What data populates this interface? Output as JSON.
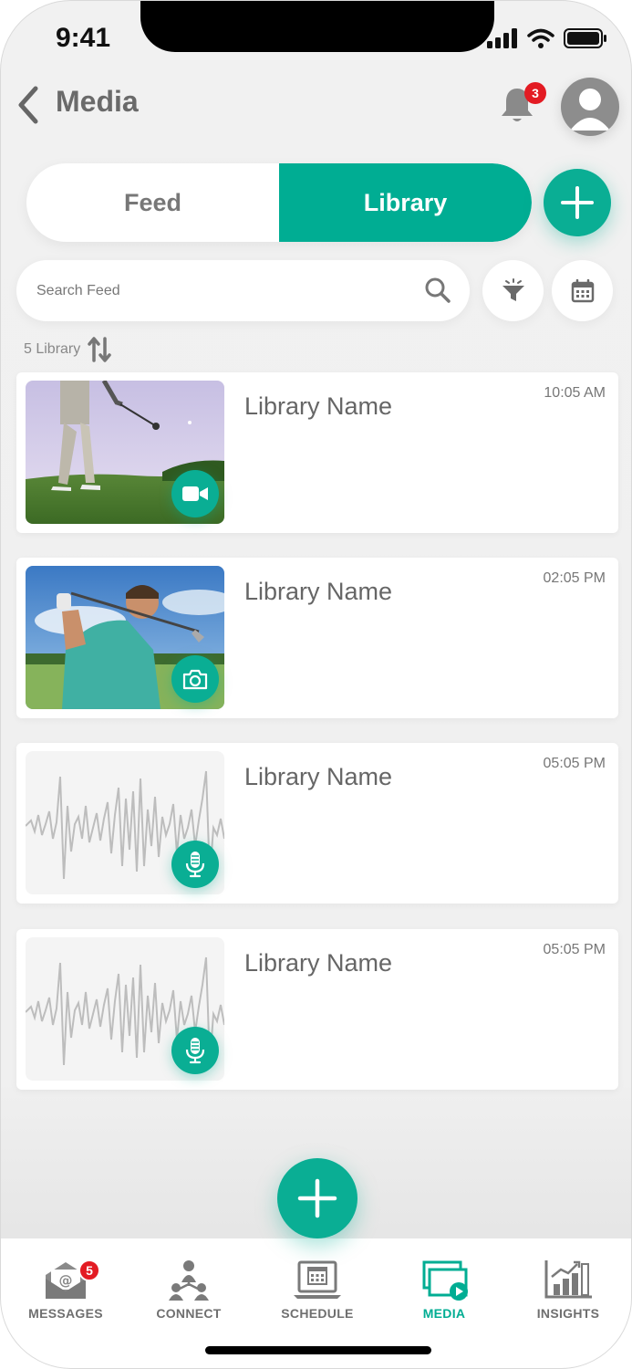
{
  "status": {
    "time": "9:41"
  },
  "header": {
    "title": "Media",
    "notification_count": "3"
  },
  "segment": {
    "feed_label": "Feed",
    "library_label": "Library",
    "active": "Library"
  },
  "search": {
    "placeholder": "Search Feed",
    "value": ""
  },
  "library": {
    "count_label": "5 Library"
  },
  "items": [
    {
      "name": "Library Name",
      "time": "10:05 AM",
      "media_type": "video",
      "badge_icon": "video-camera-icon"
    },
    {
      "name": "Library Name",
      "time": "02:05 PM",
      "media_type": "photo",
      "badge_icon": "camera-icon"
    },
    {
      "name": "Library Name",
      "time": "05:05 PM",
      "media_type": "audio",
      "badge_icon": "microphone-icon"
    },
    {
      "name": "Library Name",
      "time": "05:05 PM",
      "media_type": "audio",
      "badge_icon": "microphone-icon"
    }
  ],
  "tabbar": {
    "messages_label": "MESSAGES",
    "messages_badge": "5",
    "connect_label": "CONNECT",
    "schedule_label": "SCHEDULE",
    "media_label": "MEDIA",
    "insights_label": "INSIGHTS",
    "active": "MEDIA"
  },
  "colors": {
    "accent": "#00ad93",
    "badge": "#e31b23",
    "text": "#666666",
    "background": "#f0f0f0"
  }
}
